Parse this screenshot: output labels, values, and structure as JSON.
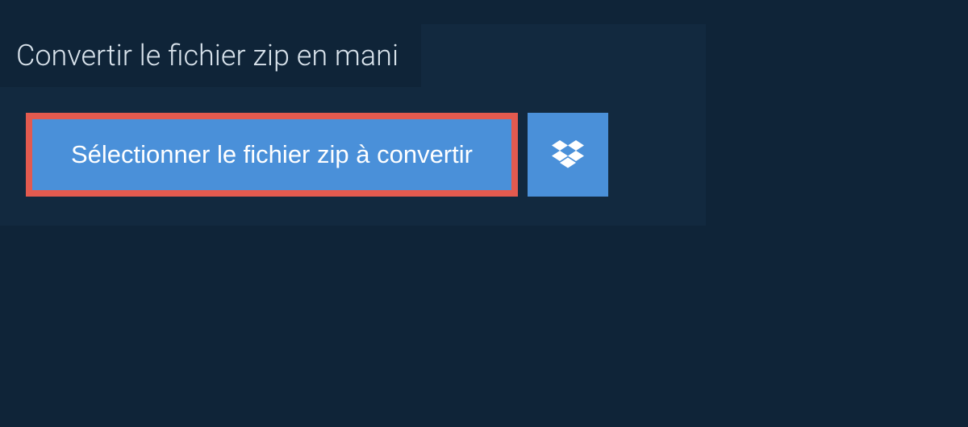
{
  "header": {
    "title": "Convertir le fichier zip en mani"
  },
  "actions": {
    "select_label": "Sélectionner le fichier zip à convertir",
    "dropbox_icon": "dropbox"
  },
  "colors": {
    "page_bg": "#0f2438",
    "panel_bg": "#12293f",
    "button_bg": "#4a90d9",
    "highlight_border": "#e35a4f",
    "title_text": "#d9e3ec"
  }
}
